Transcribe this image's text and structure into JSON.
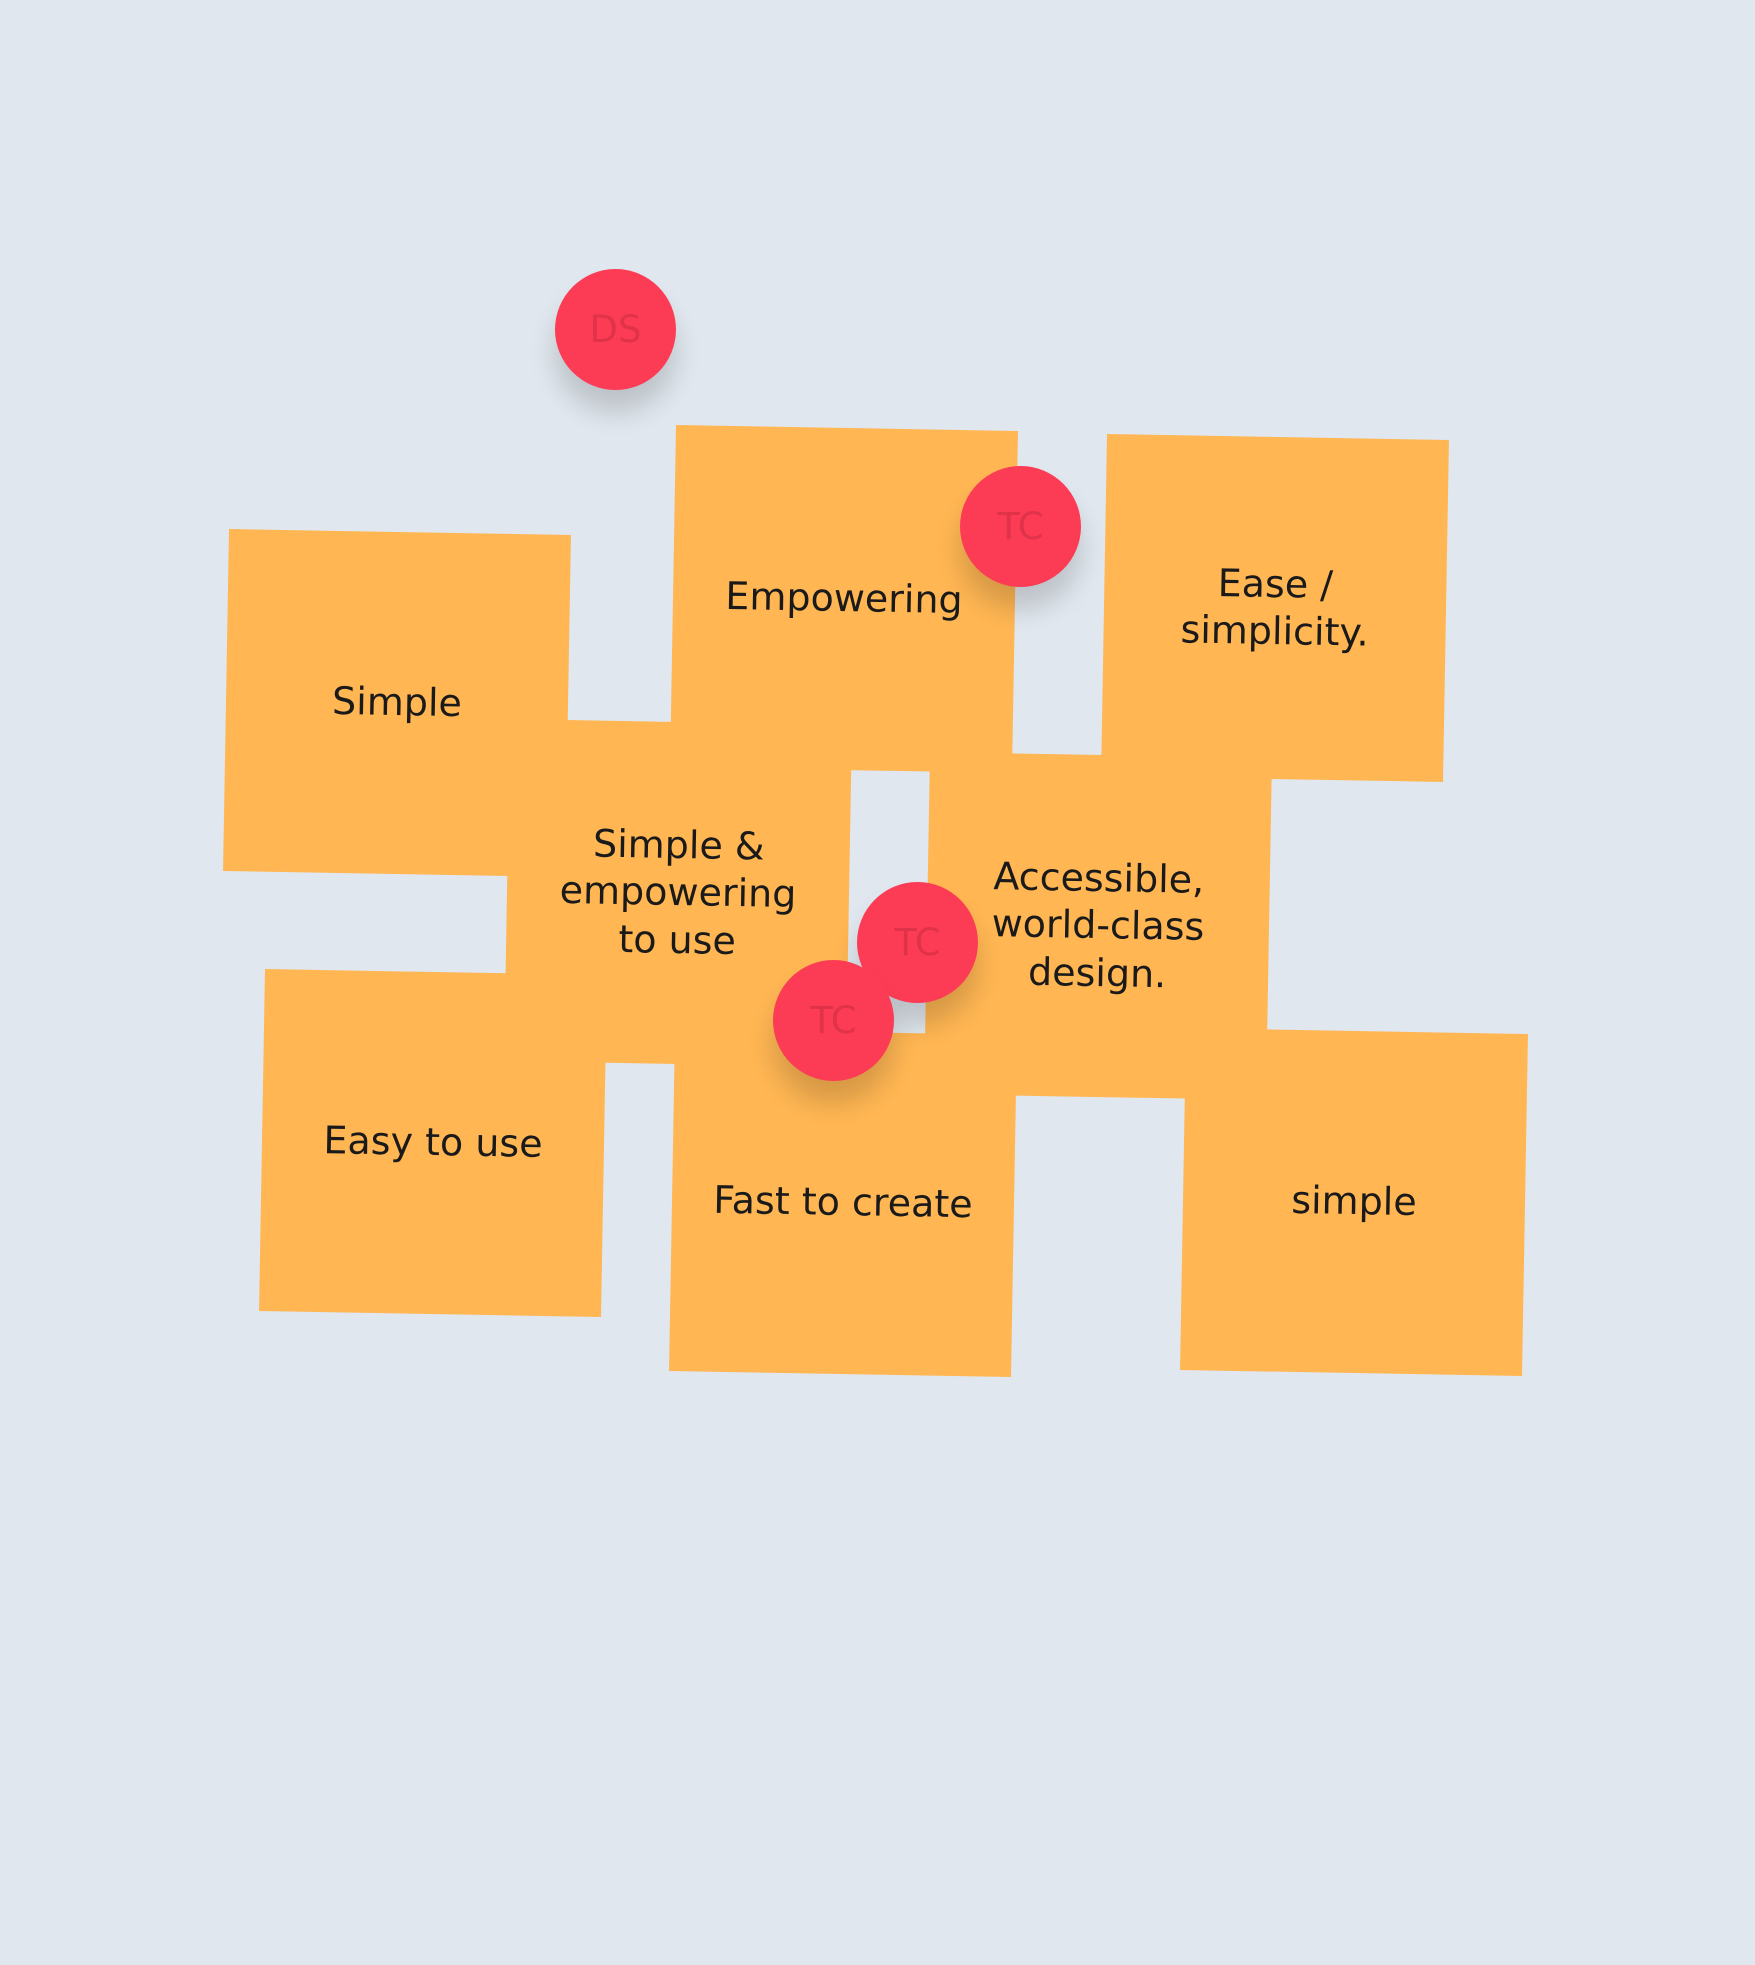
{
  "board": {
    "background_color": "#e0e7ee",
    "note_color": "#ffb653",
    "avatar_color": "#fc3c55"
  },
  "notes": [
    {
      "text": "Simple"
    },
    {
      "text": "Empowering"
    },
    {
      "text": "Ease /\nsimplicity."
    },
    {
      "text": "Simple &\nempowering\nto use"
    },
    {
      "text": "Easy to use"
    },
    {
      "text": "Accessible,\nworld-class\ndesign."
    },
    {
      "text": "Fast to create"
    },
    {
      "text": "simple"
    }
  ],
  "avatars": [
    {
      "initials": "DS"
    },
    {
      "initials": "TC"
    },
    {
      "initials": "TC"
    },
    {
      "initials": "TC"
    }
  ]
}
